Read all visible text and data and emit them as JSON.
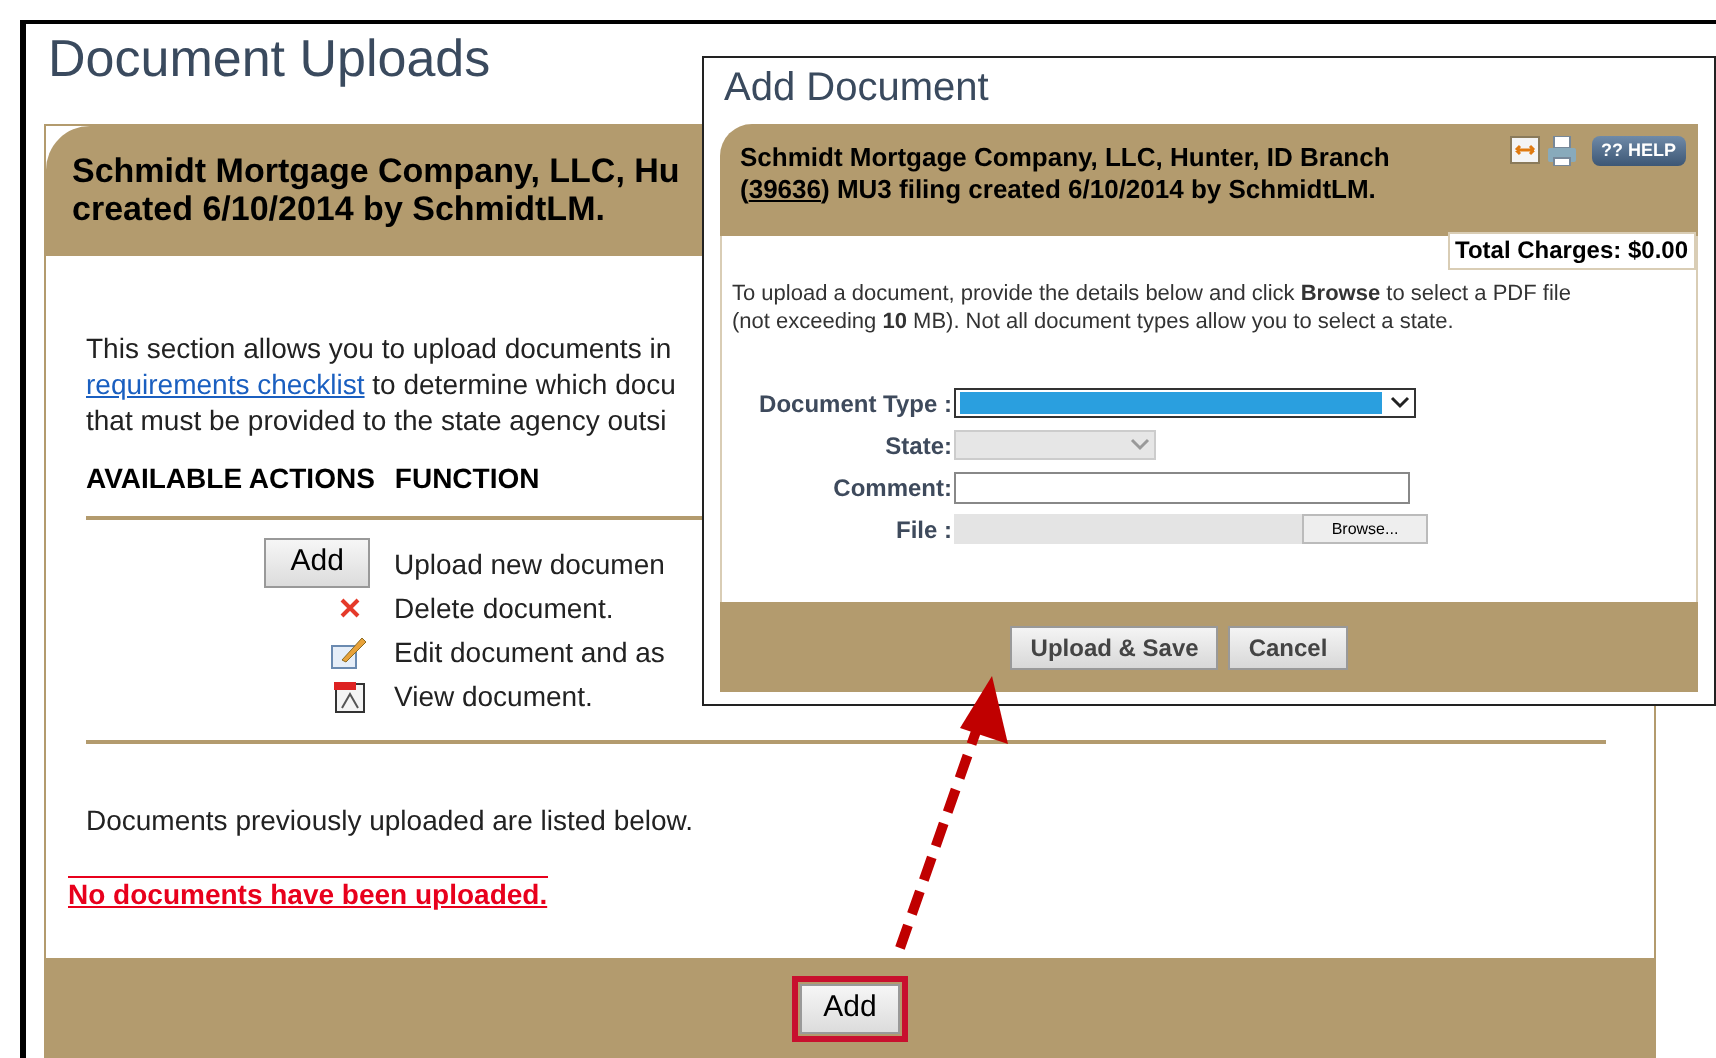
{
  "page": {
    "title": "Document Uploads"
  },
  "card": {
    "header_lines": [
      "Schmidt Mortgage Company, LLC, Hu",
      "created 6/10/2014 by SchmidtLM."
    ],
    "intro": [
      {
        "text": "This section allows you to upload documents in"
      },
      {
        "link": "requirements checklist",
        "text": " to determine which docu"
      },
      {
        "text": "that must be provided to the state agency outsi"
      }
    ],
    "actions_header": [
      "AVAILABLE ACTIONS",
      "FUNCTION"
    ],
    "actions": [
      {
        "kind": "button",
        "label": "Add",
        "function": "Upload new documen"
      },
      {
        "kind": "delete",
        "function": "Delete document."
      },
      {
        "kind": "edit",
        "function": "Edit document and as"
      },
      {
        "kind": "view",
        "function": "View document."
      }
    ],
    "listed_note": "Documents previously uploaded are listed below.",
    "empty_message": "No documents have been uploaded.",
    "footer_button": {
      "label": "Add",
      "highlighted": true
    }
  },
  "dialog": {
    "title": "Add Document",
    "header": {
      "line1": "Schmidt Mortgage Company, LLC, Hunter, ID Branch",
      "prefix": "(",
      "link": "39636",
      "suffix": ") MU3 filing created 6/10/2014 by SchmidtLM."
    },
    "help_label": "?? HELP",
    "total_charges": "Total Charges: $0.00",
    "instructions": "To upload a document, provide the details below and click **Browse** to select a PDF file (not exceeding **10** MB). Not all document types allow you to select a state.",
    "fields": [
      {
        "kind": "select",
        "label": "Document Type :",
        "focused": true,
        "disabled": false
      },
      {
        "kind": "select",
        "label": "State:",
        "focused": false,
        "disabled": true
      },
      {
        "kind": "text",
        "label": "Comment:"
      },
      {
        "kind": "file",
        "label": "File :",
        "button": "Browse..."
      }
    ],
    "buttons": [
      "Upload & Save",
      "Cancel"
    ]
  }
}
